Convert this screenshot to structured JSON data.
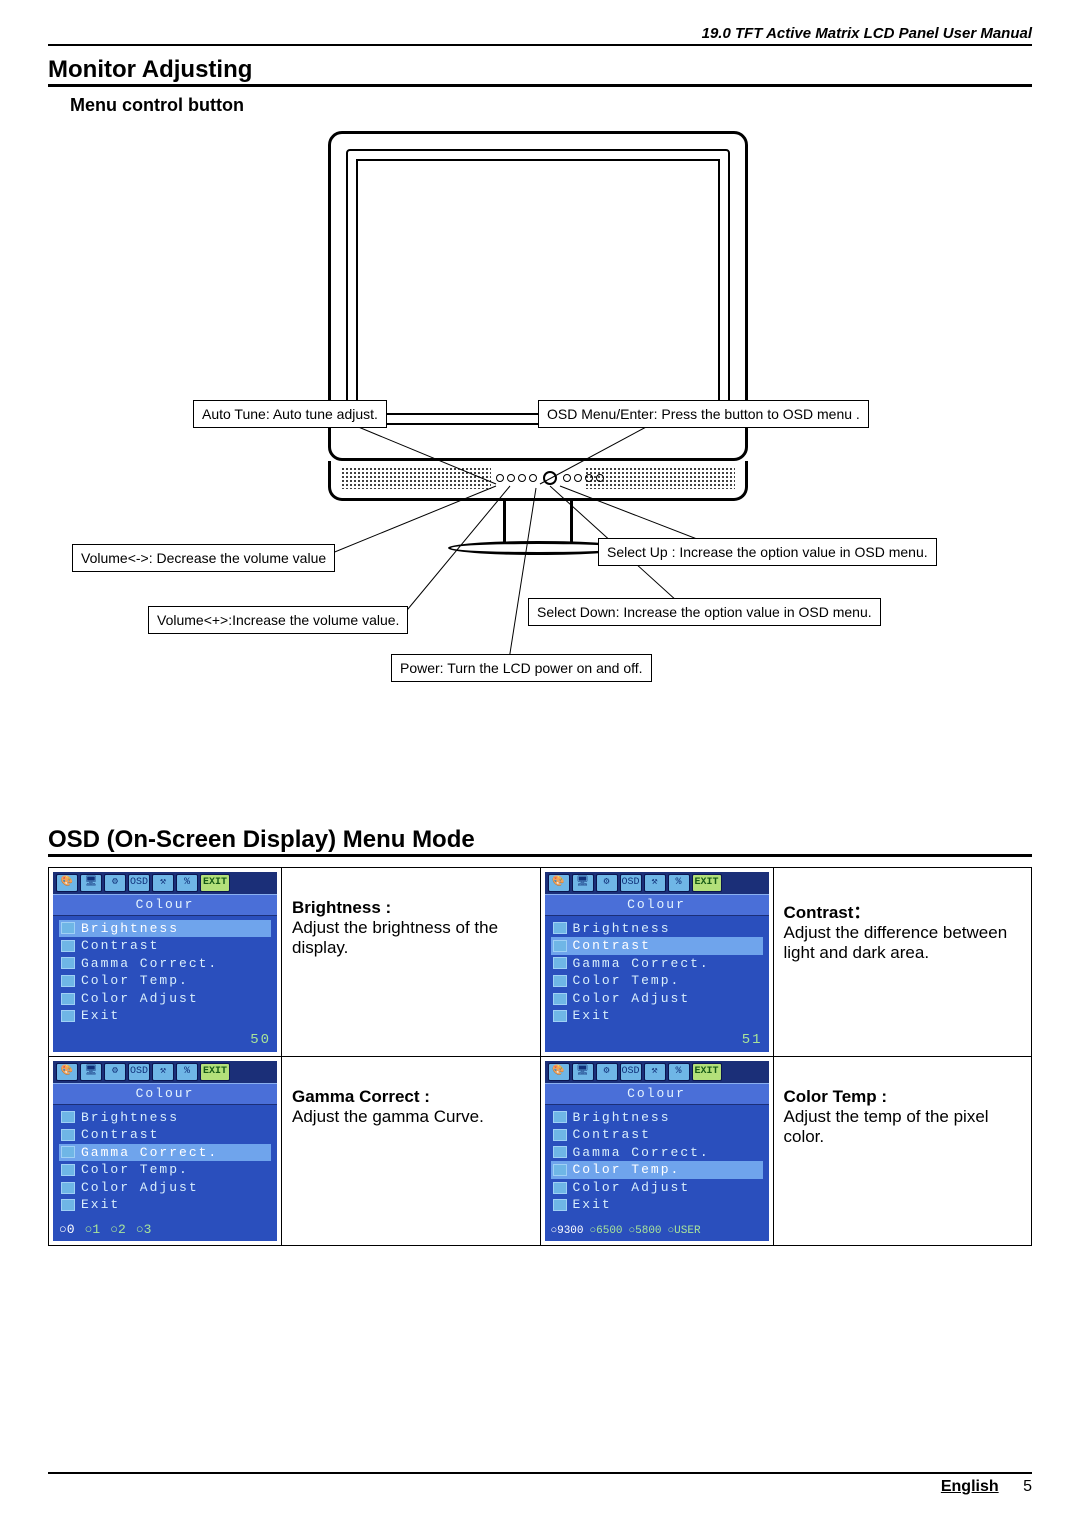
{
  "header": {
    "title": "19.0 TFT Active Matrix LCD Panel User Manual"
  },
  "section1": {
    "title": "Monitor Adjusting",
    "subtitle": "Menu control button"
  },
  "callouts": {
    "auto_tune": "Auto Tune: Auto tune adjust.",
    "osd_menu": "OSD Menu/Enter: Press the button to OSD menu .",
    "vol_down": "Volume<->: Decrease the volume value",
    "select_up": "Select Up : Increase the option value in OSD menu.",
    "vol_up": "Volume<+>:Increase the volume value.",
    "select_down": "Select Down: Increase the option value in OSD menu.",
    "power": "Power: Turn the LCD power on and off."
  },
  "section2": {
    "title": "OSD (On-Screen Display) Menu Mode"
  },
  "osd_common": {
    "panel_title": "Colour",
    "exit": "EXIT",
    "items": [
      "Brightness",
      "Contrast",
      "Gamma Correct.",
      "Color Temp.",
      "Color Adjust",
      "Exit"
    ]
  },
  "osd": [
    {
      "selected": 0,
      "bottom_value": "50",
      "desc_label": "Brightness :",
      "desc_text": "Adjust the brightness of the display."
    },
    {
      "selected": 1,
      "bottom_value": "51",
      "desc_label": "Contrast：",
      "desc_text": "Adjust the difference between light and dark area."
    },
    {
      "selected": 2,
      "bottom_options": [
        "○0",
        "○1",
        "○2",
        "○3"
      ],
      "desc_label": "Gamma Correct :",
      "desc_text": "Adjust the gamma Curve."
    },
    {
      "selected": 3,
      "bottom_options": [
        "○9300",
        "○6500",
        "○5800",
        "○USER"
      ],
      "desc_label": "Color Temp :",
      "desc_text": "Adjust the temp of the pixel color."
    }
  ],
  "footer": {
    "language": "English",
    "page": "5"
  }
}
